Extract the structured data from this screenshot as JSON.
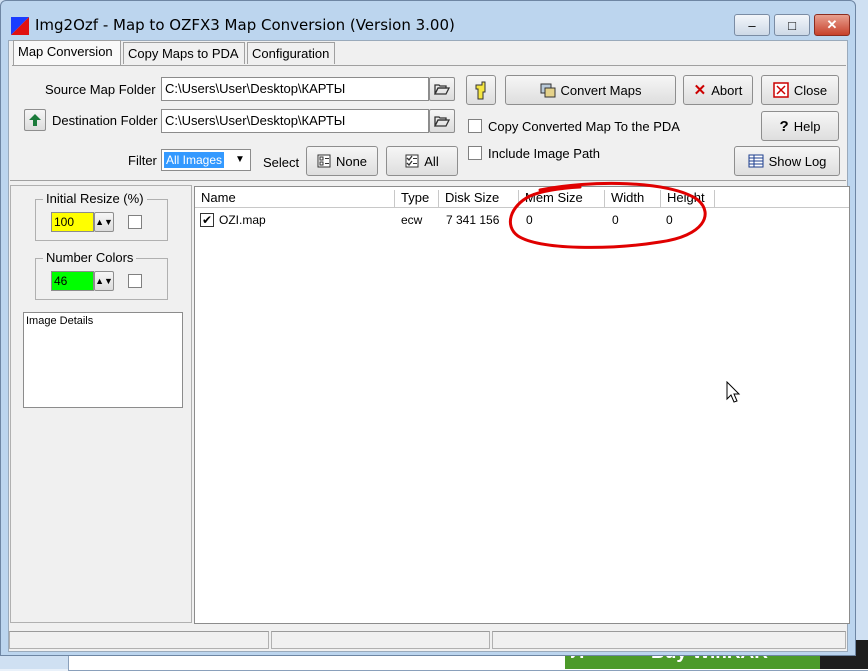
{
  "window": {
    "title": "Img2Ozf - Map to OZFX3 Map Conversion (Version 3.00)",
    "controls": {
      "minimize": "–",
      "maximize": "□",
      "close": "✕"
    }
  },
  "tabs": [
    {
      "label": "Map Conversion",
      "active": true
    },
    {
      "label": "Copy Maps to PDA",
      "active": false
    },
    {
      "label": "Configuration",
      "active": false
    }
  ],
  "source": {
    "label": "Source Map Folder",
    "value": "C:\\Users\\User\\Desktop\\КАРТЫ"
  },
  "destination": {
    "label": "Destination Folder",
    "value": "C:\\Users\\User\\Desktop\\КАРТЫ"
  },
  "filter": {
    "label": "Filter",
    "selected": "All Images"
  },
  "select": {
    "label": "Select",
    "none_label": "None",
    "all_label": "All"
  },
  "options": {
    "copy_to_pda": {
      "label": "Copy Converted Map To the PDA",
      "checked": false
    },
    "include_path": {
      "label": "Include Image Path",
      "checked": false
    }
  },
  "buttons": {
    "convert": "Convert Maps",
    "abort": "Abort",
    "close": "Close",
    "help": "Help",
    "show_log": "Show Log"
  },
  "left_panel": {
    "initial_resize": {
      "label": "Initial Resize (%)",
      "value": "100",
      "color": "#ffff00"
    },
    "number_colors": {
      "label": "Number Colors",
      "value": "46",
      "color": "#00ff00"
    },
    "image_details": {
      "label": "Image Details"
    }
  },
  "table": {
    "columns": [
      "Name",
      "Type",
      "Disk Size",
      "Mem Size",
      "Width",
      "Height"
    ],
    "rows": [
      {
        "checked": true,
        "name": "OZI.map",
        "type": "ecw",
        "disk_size": "7 341 156",
        "mem_size": "0",
        "width": "0",
        "height": "0"
      }
    ]
  },
  "annotation": {
    "color": "#e00000"
  },
  "background_app": {
    "text": "Buy WinRAR",
    "icon_text": "Л"
  },
  "colors": {
    "selection": "#3399ff",
    "window_frame": "#bcd5ee"
  }
}
